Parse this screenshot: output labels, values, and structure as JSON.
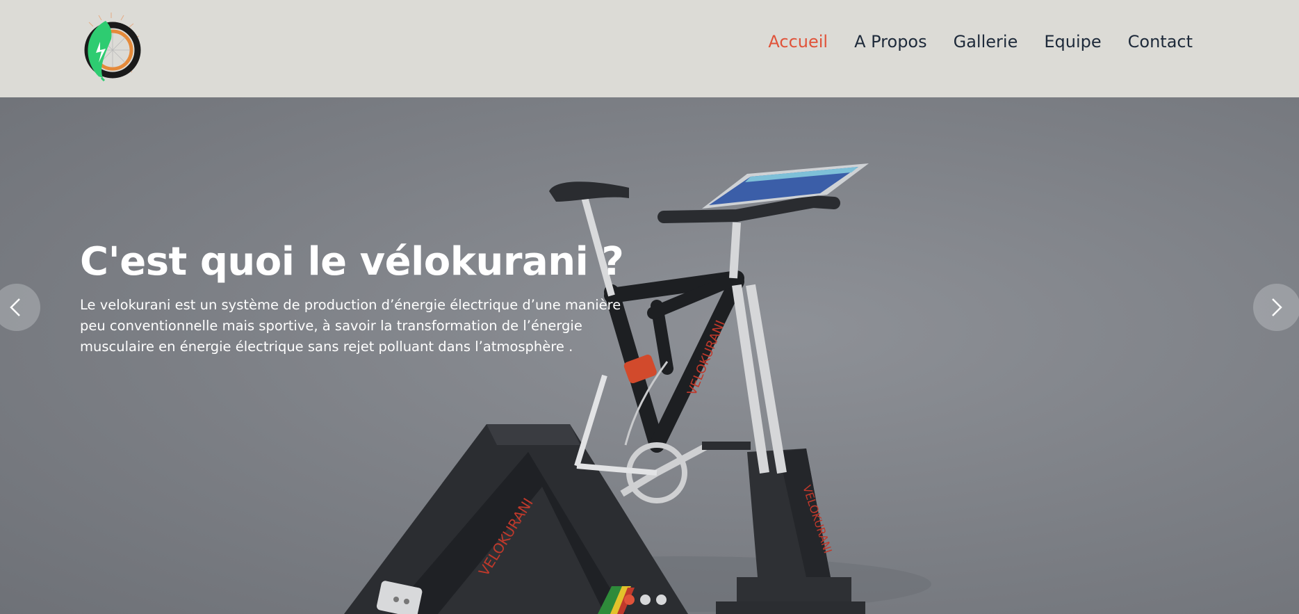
{
  "header": {
    "logo_icon": "leaf-bicycle-wheel-logo",
    "nav": [
      {
        "label": "Accueil",
        "active": true
      },
      {
        "label": "A Propos",
        "active": false
      },
      {
        "label": "Gallerie",
        "active": false
      },
      {
        "label": "Equipe",
        "active": false
      },
      {
        "label": "Contact",
        "active": false
      }
    ]
  },
  "hero": {
    "title": "C'est quoi le vélokurani ?",
    "text": "Le velokurani est un système de production d’énergie électrique d’une manière peu conventionnelle mais sportive, à savoir la transformation de l’énergie musculaire en énergie électrique sans rejet polluant dans l’atmosphère .",
    "image_labels": [
      "VELOKURANI",
      "VELOKURANI",
      "VELOKURANI"
    ],
    "prev_icon": "chevron-left-icon",
    "next_icon": "chevron-right-icon",
    "slides_count": 3,
    "active_slide": 1
  },
  "colors": {
    "accent": "#e0533a",
    "nav_text": "#1e2a3a",
    "header_bg": "#dcdbd6",
    "logo_green": "#2ecc71"
  }
}
